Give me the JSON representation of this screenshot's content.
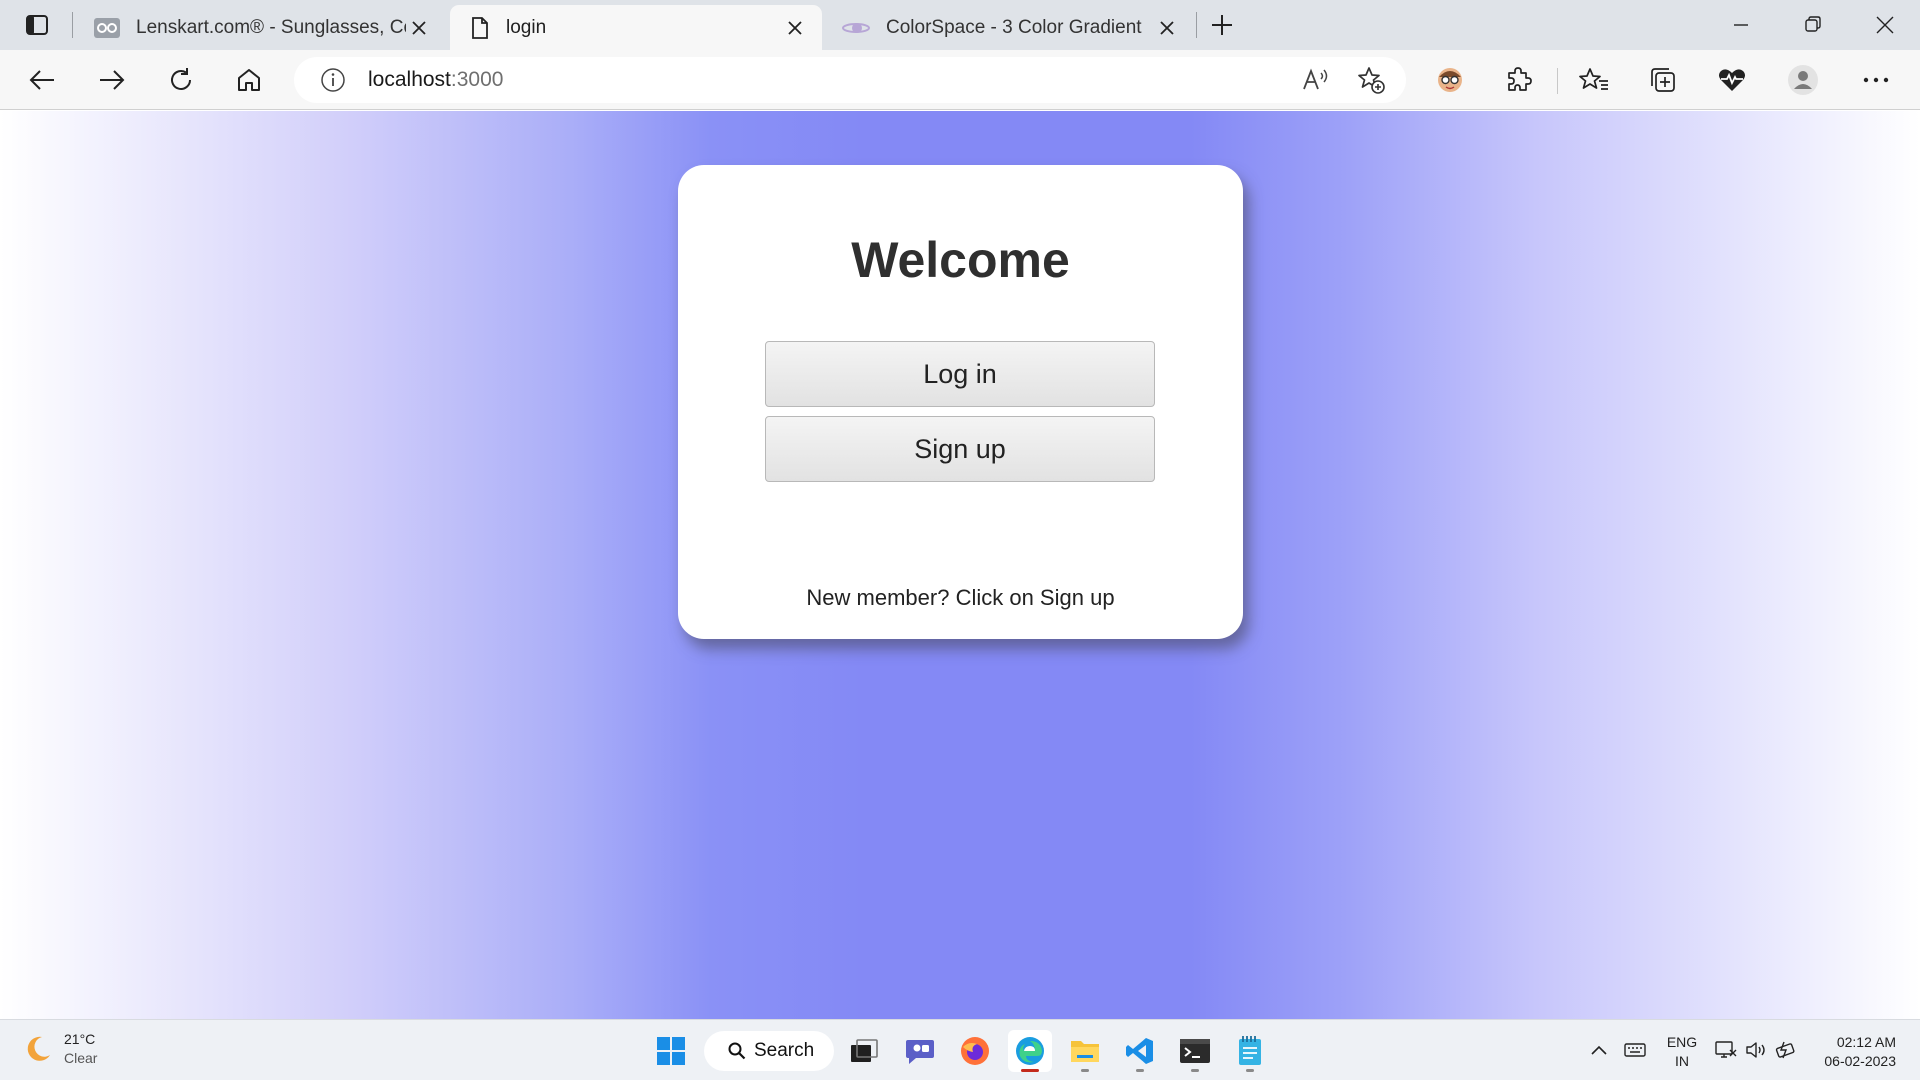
{
  "browser": {
    "tabs": [
      {
        "title": "Lenskart.com® - Sunglasses, Cor",
        "icon": "lenskart-favicon-icon",
        "active": false
      },
      {
        "title": "login",
        "icon": "page-icon",
        "active": true
      },
      {
        "title": "ColorSpace - 3 Color Gradient",
        "icon": "colorspace-favicon-icon",
        "active": false
      }
    ],
    "address": {
      "host": "localhost",
      "port": ":3000"
    },
    "toolbar_icons": [
      "back-icon",
      "forward-icon",
      "refresh-icon",
      "home-icon",
      "read-aloud-icon",
      "add-favorite-icon",
      "extension-avatar-icon",
      "extensions-icon",
      "favorites-icon",
      "collections-icon",
      "browser-essentials-icon",
      "profile-icon",
      "more-icon"
    ]
  },
  "page": {
    "background_colors": [
      "#ffffff",
      "#8489f5",
      "#ffffff"
    ],
    "card": {
      "heading": "Welcome",
      "login_label": "Log in",
      "signup_label": "Sign up",
      "note": "New member? Click on Sign up"
    }
  },
  "taskbar": {
    "weather": {
      "temp": "21°C",
      "condition": "Clear"
    },
    "search_label": "Search",
    "apps": [
      "start-icon",
      "task-view-icon",
      "chat-icon",
      "firefox-icon",
      "edge-icon",
      "file-explorer-icon",
      "vscode-icon",
      "terminal-icon",
      "notepad-icon"
    ],
    "language": {
      "line1": "ENG",
      "line2": "IN"
    },
    "clock": {
      "time": "02:12 AM",
      "date": "06-02-2023"
    }
  }
}
